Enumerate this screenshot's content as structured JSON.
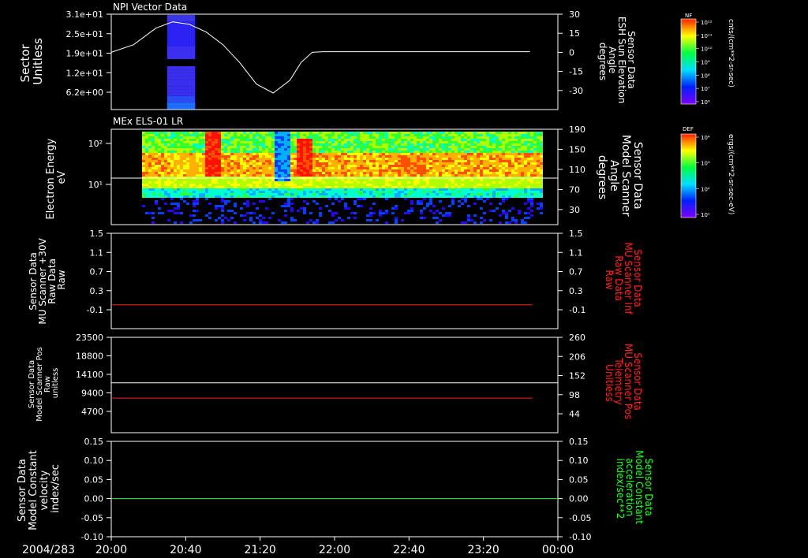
{
  "footer": {
    "date": "2004/283"
  },
  "time_axis": {
    "ticks": [
      "20:00",
      "20:40",
      "21:20",
      "22:00",
      "22:40",
      "23:20",
      "00:00"
    ]
  },
  "colors": {
    "white": "#ffffff",
    "red": "#ff2020",
    "green": "#20ff20"
  },
  "colorbars": [
    {
      "tag": "NF",
      "unit": "cnts/(cm**2-sr-sec)",
      "ticks": [
        "10¹²",
        "10¹¹",
        "10¹⁰",
        "10⁹",
        "10⁸",
        "10⁷",
        "10⁶"
      ]
    },
    {
      "tag": "DEF",
      "unit": "ergs/(cm**2-sr-sec-eV)",
      "ticks": [
        "10⁴",
        "10³",
        "10²",
        "10¹"
      ]
    }
  ],
  "chart_data": [
    {
      "type": "heatmap",
      "title": "NPI Vector Data",
      "ylabel": [
        "Sector",
        "Unitless"
      ],
      "yticks": [
        "3.1e+01",
        "2.5e+01",
        "1.9e+01",
        "1.2e+01",
        "6.2e+00"
      ],
      "y2label": [
        "Sensor Data",
        "ESH Sun Elevation",
        "Angle",
        "degrees"
      ],
      "y2ticks": [
        "30",
        "15",
        "0",
        "-15",
        "-30"
      ],
      "y2lim": [
        -45,
        30
      ],
      "overlay_series": {
        "name": "ESH Sun Elevation Angle",
        "x_hours": [
          20.0,
          20.2,
          20.4,
          20.55,
          20.7,
          20.85,
          21.0,
          21.15,
          21.3,
          21.45,
          21.6,
          21.7,
          21.8,
          21.9,
          22.0,
          22.4,
          22.8,
          23.2,
          23.6,
          23.75
        ],
        "y": [
          0,
          6,
          19,
          24,
          22,
          16,
          6,
          -8,
          -25,
          -32,
          -22,
          -8,
          0,
          0.5,
          0.5,
          0.5,
          0.5,
          0.5,
          0.5,
          0.5
        ]
      },
      "blocks": [
        {
          "start": "20:30",
          "end": "20:45",
          "rows": "upper"
        },
        {
          "start": "20:30",
          "end": "20:45",
          "rows": "lower"
        }
      ]
    },
    {
      "type": "heatmap",
      "title": "MEx ELS-01 LR",
      "ylabel": [
        "Electron Energy",
        "eV"
      ],
      "yticks": [
        "10²",
        "10¹"
      ],
      "y2label": [
        "Sensor Data",
        "Model Scanner",
        "Angle",
        "degrees"
      ],
      "y2ticks": [
        "190",
        "150",
        "110",
        "70",
        "30"
      ],
      "y2lim": [
        0,
        190
      ],
      "overlay_series": {
        "name": "Model Scanner Angle",
        "x_hours": [
          20.0,
          24.0
        ],
        "y": [
          88,
          88
        ]
      }
    },
    {
      "type": "line",
      "ylabel": [
        "Sensor Data",
        "MU Scanner +30V",
        "Raw Data",
        "Raw"
      ],
      "yticks": [
        "1.5",
        "1.1",
        "0.7",
        "0.3",
        "-0.1"
      ],
      "ylim": [
        -0.5,
        1.5
      ],
      "y2label": [
        "Sensor Data",
        "MU Scanner Inf",
        "Raw Data",
        "Raw"
      ],
      "y2ticks": [
        "1.5",
        "1.1",
        "0.7",
        "0.3",
        "-0.1"
      ],
      "series": [
        {
          "x_hours": [
            20.0,
            23.77
          ],
          "y": [
            0.0,
            0.0
          ]
        }
      ]
    },
    {
      "type": "line",
      "ylabel": [
        "Sensor Data",
        "Model Scanner Pos",
        "Raw",
        "unitless"
      ],
      "yticks": [
        "23500",
        "18800",
        "14100",
        "9400",
        "4700"
      ],
      "ylim": [
        0,
        23500
      ],
      "y2label": [
        "Sensor Data",
        "MU Scanner Pos",
        "Telemetry",
        "Unitless"
      ],
      "y2ticks": [
        "260",
        "206",
        "152",
        "98",
        "44"
      ],
      "y2lim": [
        -10,
        260
      ],
      "series": [
        {
          "axis": "left",
          "x_hours": [
            20.0,
            24.0
          ],
          "y": [
            11900,
            11900
          ]
        },
        {
          "axis": "right",
          "x_hours": [
            20.0,
            23.77
          ],
          "y": [
            88,
            88
          ]
        }
      ]
    },
    {
      "type": "line",
      "ylabel": [
        "Sensor Data",
        "Model Constant",
        "velocity",
        "index/sec"
      ],
      "yticks": [
        "0.15",
        "0.10",
        "0.05",
        "0.00",
        "-0.05",
        "-0.10"
      ],
      "ylim": [
        -0.1,
        0.15
      ],
      "y2label": [
        "Sensor Data",
        "Model Constant",
        "acceleration",
        "index/sec**2"
      ],
      "y2ticks": [
        "0.15",
        "0.10",
        "0.05",
        "0.00",
        "-0.05",
        "-0.10"
      ],
      "series": [
        {
          "x_hours": [
            20.0,
            24.0
          ],
          "y": [
            0.0,
            0.0
          ]
        }
      ]
    }
  ]
}
